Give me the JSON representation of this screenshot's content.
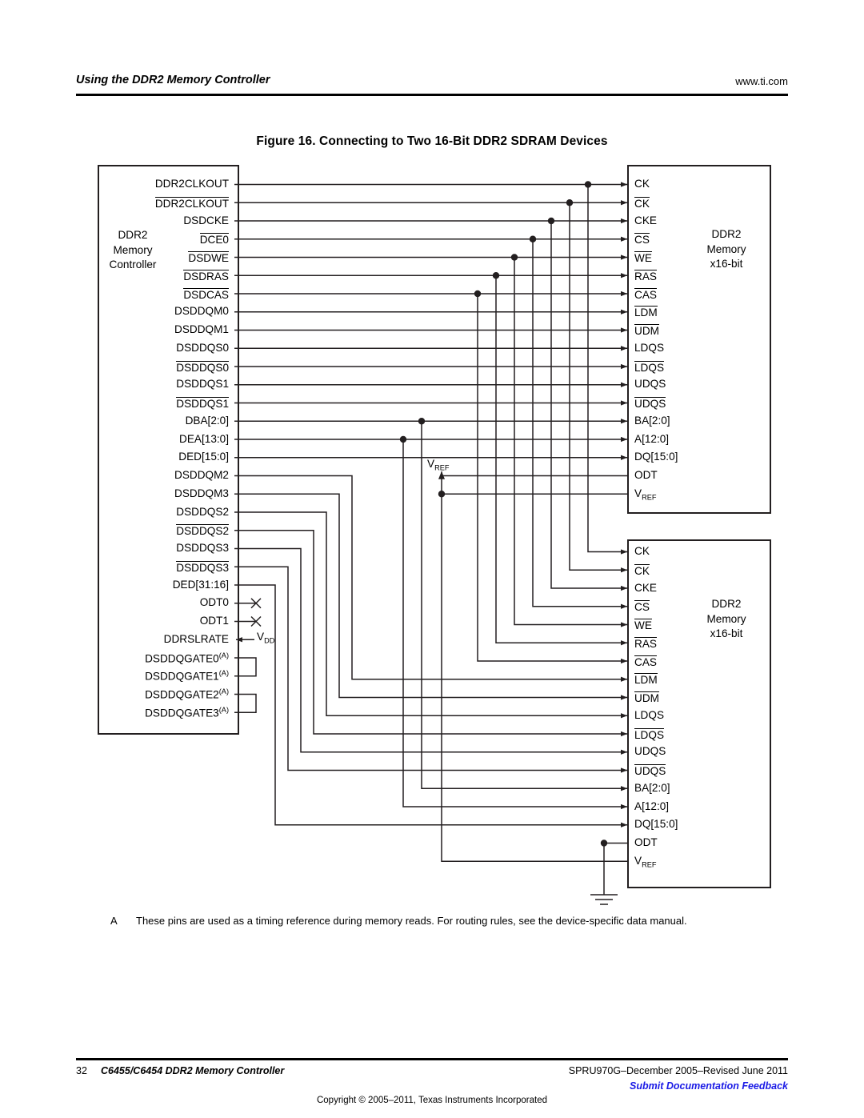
{
  "header": {
    "left_title": "Using the DDR2 Memory Controller",
    "right_url": "www.ti.com"
  },
  "figure": {
    "title": "Figure 16. Connecting to Two 16-Bit DDR2 SDRAM Devices"
  },
  "controller": {
    "title_lines": [
      "DDR2",
      "Memory",
      "Controller"
    ],
    "pins": [
      {
        "label": "DDR2CLKOUT",
        "overline": false
      },
      {
        "label": "DDR2CLKOUT",
        "overline": true
      },
      {
        "label": "DSDCKE",
        "overline": false
      },
      {
        "label": "DCE0",
        "overline": true
      },
      {
        "label": "DSDWE",
        "overline": true
      },
      {
        "label": "DSDRAS",
        "overline": true
      },
      {
        "label": "DSDCAS",
        "overline": true
      },
      {
        "label": "DSDDQM0",
        "overline": false
      },
      {
        "label": "DSDDQM1",
        "overline": false
      },
      {
        "label": "DSDDQS0",
        "overline": false
      },
      {
        "label": "DSDDQS0",
        "overline": true
      },
      {
        "label": "DSDDQS1",
        "overline": false
      },
      {
        "label": "DSDDQS1",
        "overline": true
      },
      {
        "label": "DBA[2:0]",
        "overline": false
      },
      {
        "label": "DEA[13:0]",
        "overline": false
      },
      {
        "label": "DED[15:0]",
        "overline": false
      },
      {
        "label": "DSDDQM2",
        "overline": false
      },
      {
        "label": "DSDDQM3",
        "overline": false
      },
      {
        "label": "DSDDQS2",
        "overline": false
      },
      {
        "label": "DSDDQS2",
        "overline": true
      },
      {
        "label": "DSDDQS3",
        "overline": false
      },
      {
        "label": "DSDDQS3",
        "overline": true
      },
      {
        "label": "DED[31:16]",
        "overline": false
      },
      {
        "label": "ODT0",
        "overline": false
      },
      {
        "label": "ODT1",
        "overline": false
      },
      {
        "label": "DDRSLRATE",
        "overline": false
      },
      {
        "label": "DSDDQGATE0",
        "overline": false,
        "note": "(A)"
      },
      {
        "label": "DSDDQGATE1",
        "overline": false,
        "note": "(A)"
      },
      {
        "label": "DSDDQGATE2",
        "overline": false,
        "note": "(A)"
      },
      {
        "label": "DSDDQGATE3",
        "overline": false,
        "note": "(A)"
      }
    ],
    "vdd_label": "V",
    "vdd_sub": "DD"
  },
  "memory1": {
    "title_lines": [
      "DDR2",
      "Memory",
      "x16-bit"
    ],
    "pins": [
      {
        "label": "CK",
        "overline": false,
        "arrow": true
      },
      {
        "label": "CK",
        "overline": true,
        "arrow": true
      },
      {
        "label": "CKE",
        "overline": false,
        "arrow": true
      },
      {
        "label": "CS",
        "overline": true,
        "arrow": true
      },
      {
        "label": "WE",
        "overline": true,
        "arrow": true
      },
      {
        "label": "RAS",
        "overline": true,
        "arrow": true
      },
      {
        "label": "CAS",
        "overline": true,
        "arrow": true
      },
      {
        "label": "LDM",
        "overline": true,
        "arrow": true
      },
      {
        "label": "UDM",
        "overline": true,
        "arrow": true
      },
      {
        "label": "LDQS",
        "overline": false,
        "arrow": true
      },
      {
        "label": "LDQS",
        "overline": true,
        "arrow": true
      },
      {
        "label": "UDQS",
        "overline": false,
        "arrow": true
      },
      {
        "label": "UDQS",
        "overline": true,
        "arrow": true
      },
      {
        "label": "BA[2:0]",
        "overline": false,
        "arrow": true
      },
      {
        "label": "A[12:0]",
        "overline": false,
        "arrow": true
      },
      {
        "label": "DQ[15:0]",
        "overline": false,
        "arrow": true
      },
      {
        "label": "ODT",
        "overline": false,
        "arrow": false
      },
      {
        "label": "VREF",
        "overline": false,
        "arrow": false
      }
    ]
  },
  "memory2": {
    "title_lines": [
      "DDR2",
      "Memory",
      "x16-bit"
    ],
    "pins": [
      {
        "label": "CK",
        "overline": false,
        "arrow": true
      },
      {
        "label": "CK",
        "overline": true,
        "arrow": true
      },
      {
        "label": "CKE",
        "overline": false,
        "arrow": true
      },
      {
        "label": "CS",
        "overline": true,
        "arrow": true
      },
      {
        "label": "WE",
        "overline": true,
        "arrow": true
      },
      {
        "label": "RAS",
        "overline": true,
        "arrow": true
      },
      {
        "label": "CAS",
        "overline": true,
        "arrow": true
      },
      {
        "label": "LDM",
        "overline": true,
        "arrow": true
      },
      {
        "label": "UDM",
        "overline": true,
        "arrow": true
      },
      {
        "label": "LDQS",
        "overline": false,
        "arrow": true
      },
      {
        "label": "LDQS",
        "overline": true,
        "arrow": true
      },
      {
        "label": "UDQS",
        "overline": false,
        "arrow": true
      },
      {
        "label": "UDQS",
        "overline": true,
        "arrow": true
      },
      {
        "label": "BA[2:0]",
        "overline": false,
        "arrow": true
      },
      {
        "label": "A[12:0]",
        "overline": false,
        "arrow": true
      },
      {
        "label": "DQ[15:0]",
        "overline": false,
        "arrow": true
      },
      {
        "label": "ODT",
        "overline": false,
        "arrow": false
      },
      {
        "label": "VREF",
        "overline": false,
        "arrow": false
      }
    ]
  },
  "vref_marker": {
    "label": "V",
    "sub": "REF"
  },
  "footnote": {
    "marker": "A",
    "text": "These pins are used as a timing reference during memory reads. For routing rules, see the device-specific data manual."
  },
  "footer": {
    "page": "32",
    "doc_title": "C6455/C6454 DDR2 Memory Controller",
    "spec": "SPRU970G–December 2005–Revised June 2011",
    "feedback": "Submit Documentation Feedback",
    "copyright": "Copyright © 2005–2011, Texas Instruments Incorporated"
  },
  "colors": {
    "ink": "#231f20",
    "link": "#1a1ae6"
  }
}
